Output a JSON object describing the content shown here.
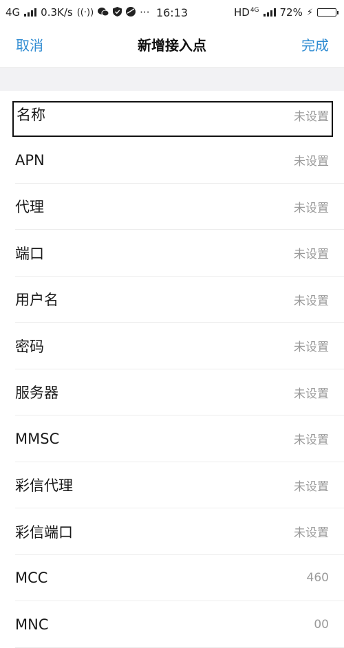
{
  "status_bar": {
    "network": "4G",
    "speed": "0.3K/s",
    "more": "···",
    "time": "16:13",
    "hd": "HD",
    "network_right": "4G",
    "battery": "72%",
    "battery_level_percent": 72
  },
  "nav": {
    "cancel_label": "取消",
    "title": "新增接入点",
    "done_label": "完成"
  },
  "rows": [
    {
      "label": "名称",
      "value": "未设置"
    },
    {
      "label": "APN",
      "value": "未设置"
    },
    {
      "label": "代理",
      "value": "未设置"
    },
    {
      "label": "端口",
      "value": "未设置"
    },
    {
      "label": "用户名",
      "value": "未设置"
    },
    {
      "label": "密码",
      "value": "未设置"
    },
    {
      "label": "服务器",
      "value": "未设置"
    },
    {
      "label": "MMSC",
      "value": "未设置"
    },
    {
      "label": "彩信代理",
      "value": "未设置"
    },
    {
      "label": "彩信端口",
      "value": "未设置"
    },
    {
      "label": "MCC",
      "value": "460"
    },
    {
      "label": "MNC",
      "value": "00"
    }
  ],
  "colors": {
    "accent": "#2e8bd2",
    "section_bg": "#f2f2f4",
    "value_text": "#9a9a9a"
  },
  "icons": [
    "signal-bars-icon",
    "nfc-icon",
    "wechat-icon",
    "shield-icon",
    "browser-icon",
    "charging-bolt-icon",
    "battery-icon"
  ]
}
